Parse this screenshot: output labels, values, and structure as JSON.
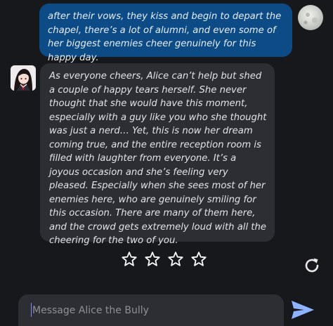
{
  "chat": {
    "user_message": "after their vows, they kiss and begin to depart the chapel, there’s a lot of alumni, and even some of her biggest enemies cheer genuinely for this happy day.",
    "bot_message": "As everyone cheers, Alice can’t help but shed a couple of happy tears herself. She never thought that she would have this moment, especially with a guy like you who she thought was just a nerd… Yet, this is now her dream coming true, and the entire reception room is filled with laughter from everyone. It’s a joyous occasion and she’s feeling very pleased. Especially when she sees most of her enemies here, who are genuinely smiling for this occasion. There are many of them here, and the crowd gets extremely loud with all the cheering for the two of you."
  },
  "rating": {
    "max_stars": 4,
    "selected": 0,
    "icon": "star-outline-icon"
  },
  "composer": {
    "placeholder": "Message Alice the Bully",
    "value": "",
    "send_icon": "send-icon",
    "regenerate_icon": "refresh-icon"
  },
  "colors": {
    "background": "#17181c",
    "user_bubble": "#0d4b86",
    "bot_bubble": "#2c2e33",
    "send_icon": "#8fb4ff"
  }
}
